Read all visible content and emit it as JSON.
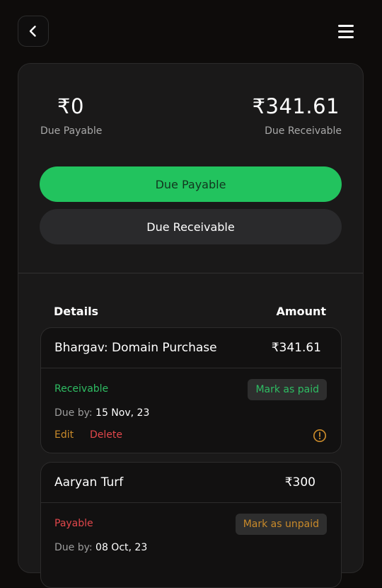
{
  "header": {
    "back_icon": "chevron-left-icon",
    "menu_icon": "hamburger-menu-icon"
  },
  "summary": {
    "payable_amount": "₹0",
    "payable_label": "Due Payable",
    "receivable_amount": "₹341.61",
    "receivable_label": "Due Receivable"
  },
  "tabs": [
    {
      "label": "Due Payable",
      "active": true
    },
    {
      "label": "Due Receivable",
      "active": false
    }
  ],
  "table": {
    "details_header": "Details",
    "amount_header": "Amount"
  },
  "entries": [
    {
      "title": "Bhargav: Domain Purchase",
      "amount": "₹341.61",
      "status": "Receivable",
      "action": "Mark as paid",
      "due_prefix": "Due by: ",
      "due_date": "15 Nov, 23",
      "edit": "Edit",
      "delete": "Delete",
      "alert_icon": "exclamation-circle-icon"
    },
    {
      "title": "Aaryan Turf",
      "amount": "₹300",
      "status": "Payable",
      "action": "Mark as unpaid",
      "due_prefix": "Due by: ",
      "due_date": "08 Oct, 23"
    }
  ],
  "colors": {
    "accent_green": "#22c35e",
    "receivable_text": "#2ebd63",
    "payable_text": "#e2474b",
    "warning": "#c98a2a"
  }
}
